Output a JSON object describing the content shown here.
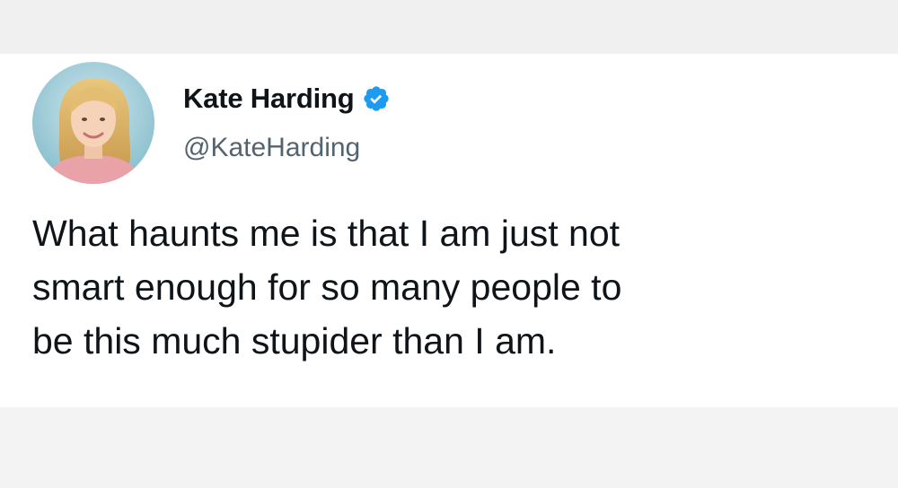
{
  "tweet": {
    "author": {
      "display_name": "Kate Harding",
      "handle": "@KateHarding",
      "verified": true,
      "verified_color": "#1d9bf0"
    },
    "text_lines": [
      "What haunts me is that I am just not",
      "smart enough for so many people to",
      "be this much stupider than I am."
    ]
  },
  "icons": {
    "avatar": "profile-photo",
    "verified": "verified-checkmark-icon"
  },
  "colors": {
    "background": "#f3f3f3",
    "card": "#ffffff",
    "text": "#0f1419",
    "handle": "#536471"
  }
}
